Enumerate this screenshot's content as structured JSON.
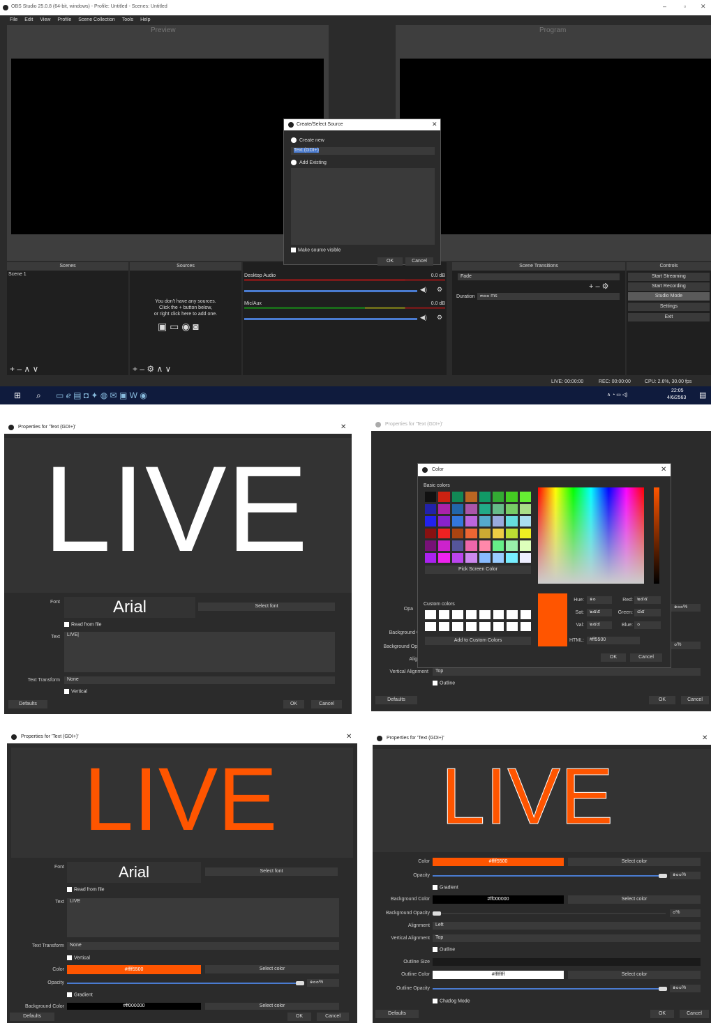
{
  "obs": {
    "title": "OBS Studio 25.0.8 (64-bit, windows) - Profile: Untitled - Scenes: Untitled",
    "menu": [
      "File",
      "Edit",
      "View",
      "Profile",
      "Scene Collection",
      "Tools",
      "Help"
    ],
    "preview_label": "Preview",
    "program_label": "Program",
    "docks": {
      "scenes": "Scenes",
      "sources": "Sources",
      "transitions": "Scene Transitions",
      "controls": "Controls"
    },
    "scene_item": "Scene 1",
    "sources_empty": [
      "You don't have any sources.",
      "Click the + button below,",
      "or right click here to add one."
    ],
    "mixer": [
      {
        "name": "Desktop Audio",
        "db": "0.0 dB"
      },
      {
        "name": "Mic/Aux",
        "db": "0.0 dB"
      }
    ],
    "transition": "Fade",
    "duration_label": "Duration",
    "duration_value": "๓๐๐ ms",
    "controls": [
      "Start Streaming",
      "Start Recording",
      "Studio Mode",
      "Settings",
      "Exit"
    ],
    "status": {
      "live": "LIVE: 00:00:00",
      "rec": "REC: 00:00:00",
      "cpu": "CPU: 2.6%, 30.00 fps"
    },
    "clock": {
      "time": "22:05",
      "date": "4/6/2563"
    },
    "dialog": {
      "title": "Create/Select Source",
      "create_new": "Create new",
      "name_value": "Text (GDI+)",
      "add_existing": "Add Existing",
      "make_visible": "Make source visible",
      "ok": "OK",
      "cancel": "Cancel"
    }
  },
  "p1": {
    "title": "Properties for 'Text (GDI+)'",
    "preview_text": "LIVE",
    "font_label": "Font",
    "font_value": "Arial",
    "select_font": "Select font",
    "read_from_file": "Read from file",
    "text_label": "Text",
    "text_value": "LIVE|",
    "transform_label": "Text Transform",
    "transform_value": "None",
    "vertical": "Vertical",
    "defaults": "Defaults",
    "ok": "OK",
    "cancel": "Cancel"
  },
  "p2": {
    "title": "Properties for 'Text (GDI+)'",
    "color_title": "Color",
    "basic_colors": "Basic colors",
    "pick_screen": "Pick Screen Color",
    "custom_colors": "Custom colors",
    "add_custom": "Add to Custom Colors",
    "hue_label": "Hue:",
    "hue": "๑๐",
    "sat_label": "Sat:",
    "sat": "๒๕๕",
    "val_label": "Val:",
    "val": "๒๕๕",
    "red_label": "Red:",
    "red": "๒๕๕",
    "green_label": "Green:",
    "green": "๘๕",
    "blue_label": "Blue:",
    "blue": "๐",
    "html_label": "HTML:",
    "html": "#ff5500",
    "ok": "OK",
    "cancel": "Cancel",
    "bg_labels": [
      "Opa",
      "Background C",
      "Background Opa",
      "Align",
      "Vertical Alignment"
    ],
    "pct1": "๑๐๐%",
    "pct2": "๐%",
    "valign": "Top",
    "outline": "Outline",
    "defaults": "Defaults",
    "ok2": "OK",
    "cancel2": "Cancel"
  },
  "p3": {
    "title": "Properties for 'Text (GDI+)'",
    "preview_text": "LIVE",
    "font_label": "Font",
    "font_value": "Arial",
    "select_font": "Select font",
    "read_from_file": "Read from file",
    "text_label": "Text",
    "text_value": "LIVE",
    "transform_label": "Text Transform",
    "transform_value": "None",
    "vertical": "Vertical",
    "color_label": "Color",
    "color_value": "#ffff5500",
    "select_color": "Select color",
    "opacity_label": "Opacity",
    "opacity_value": "๑๐๐%",
    "gradient": "Gradient",
    "bg_label": "Background Color",
    "bg_value": "#ff000000",
    "defaults": "Defaults",
    "ok": "OK",
    "cancel": "Cancel"
  },
  "p4": {
    "title": "Properties for 'Text (GDI+)'",
    "preview_text": "LIVE",
    "rows": [
      {
        "label": "Color",
        "value": "#ffff5500",
        "btn": "Select color"
      },
      {
        "label": "Background Color",
        "value": "#ff000000",
        "btn": "Select color"
      },
      {
        "label": "Outline Color",
        "value": "#ffffffff",
        "btn": "Select color"
      }
    ],
    "opacity_label": "Opacity",
    "opacity_value": "๑๐๐%",
    "gradient": "Gradient",
    "bg_opacity_label": "Background Opacity",
    "bg_opacity_value": "๐%",
    "align_label": "Alignment",
    "align_value": "Left",
    "valign_label": "Vertical Alignment",
    "valign_value": "Top",
    "outline": "Outline",
    "outline_size_label": "Outline Size",
    "outline_opacity_label": "Outline Opacity",
    "outline_opacity_value": "๑๐๐%",
    "chatlog": "Chatlog Mode",
    "defaults": "Defaults",
    "ok": "OK",
    "cancel": "Cancel"
  },
  "colors": {
    "accent": "#ff5500",
    "panel": "#2b2b2b",
    "select": "#4a7bd0"
  }
}
